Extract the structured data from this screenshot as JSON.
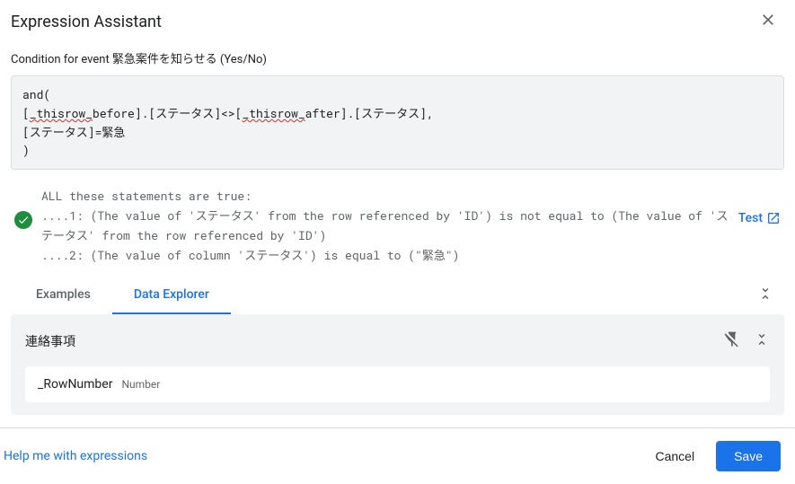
{
  "header": {
    "title": "Expression Assistant"
  },
  "condition_label": "Condition for event 緊急案件を知らせる (Yes/No)",
  "expression": {
    "line1": "and(",
    "line2_p1": "[",
    "line2_p2": "_thisrow_",
    "line2_p3": "before].[ステータス]<>[",
    "line2_p4": "_thisrow_",
    "line2_p5": "after].[ステータス],",
    "line3": "[ステータス]=緊急",
    "line4": ")"
  },
  "validation": {
    "text": "ALL these statements are true:\n....1: (The value of 'ステータス' from the row referenced by 'ID') is not equal to (The value of 'ステータス' from the row referenced by 'ID')\n....2: (The value of column 'ステータス') is equal to (\"緊急\")"
  },
  "test_link": "Test",
  "tabs": {
    "examples": "Examples",
    "data_explorer": "Data Explorer"
  },
  "data_explorer": {
    "table_name": "連絡事項",
    "columns": [
      {
        "name": "_RowNumber",
        "type": "Number"
      }
    ]
  },
  "footer": {
    "help_link": "Help me with expressions",
    "cancel": "Cancel",
    "save": "Save"
  }
}
